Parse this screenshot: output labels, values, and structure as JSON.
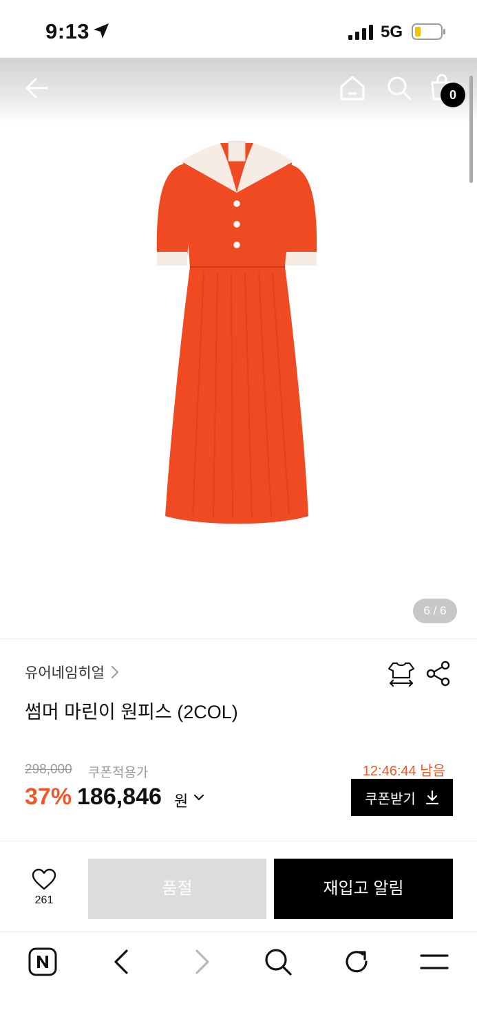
{
  "status_bar": {
    "time": "9:13",
    "network": "5G",
    "icons": [
      "location-arrow-icon",
      "signal-icon",
      "battery-icon"
    ]
  },
  "header": {
    "icons": [
      "back-arrow-icon",
      "home-icon",
      "search-icon",
      "cart-icon"
    ],
    "cart_count": "0"
  },
  "gallery": {
    "pager": "6 / 6",
    "image_icon": "dress-image",
    "dress_color": "#f04a22"
  },
  "product": {
    "brand": "유어네임히얼",
    "title": "썸머 마린이 원피스 (2COL)",
    "original_price": "298,000",
    "coupon_label": "쿠폰적용가",
    "discount": "37%",
    "price": "186,846",
    "currency": "원",
    "timer": "12:46:44 남음",
    "coupon_button": "쿠폰받기",
    "accent_color": "#f0582b",
    "icons": [
      "hanger-size-icon",
      "share-icon",
      "chevron-right-icon",
      "chevron-down-icon",
      "download-icon"
    ]
  },
  "actions": {
    "like_count": "261",
    "soldout_label": "품절",
    "restock_label": "재입고 알림",
    "icons": [
      "heart-icon"
    ]
  },
  "browser_toolbar": {
    "icons": [
      "naver-icon",
      "back-icon",
      "forward-icon",
      "search-icon",
      "reload-icon",
      "menu-icon"
    ]
  }
}
